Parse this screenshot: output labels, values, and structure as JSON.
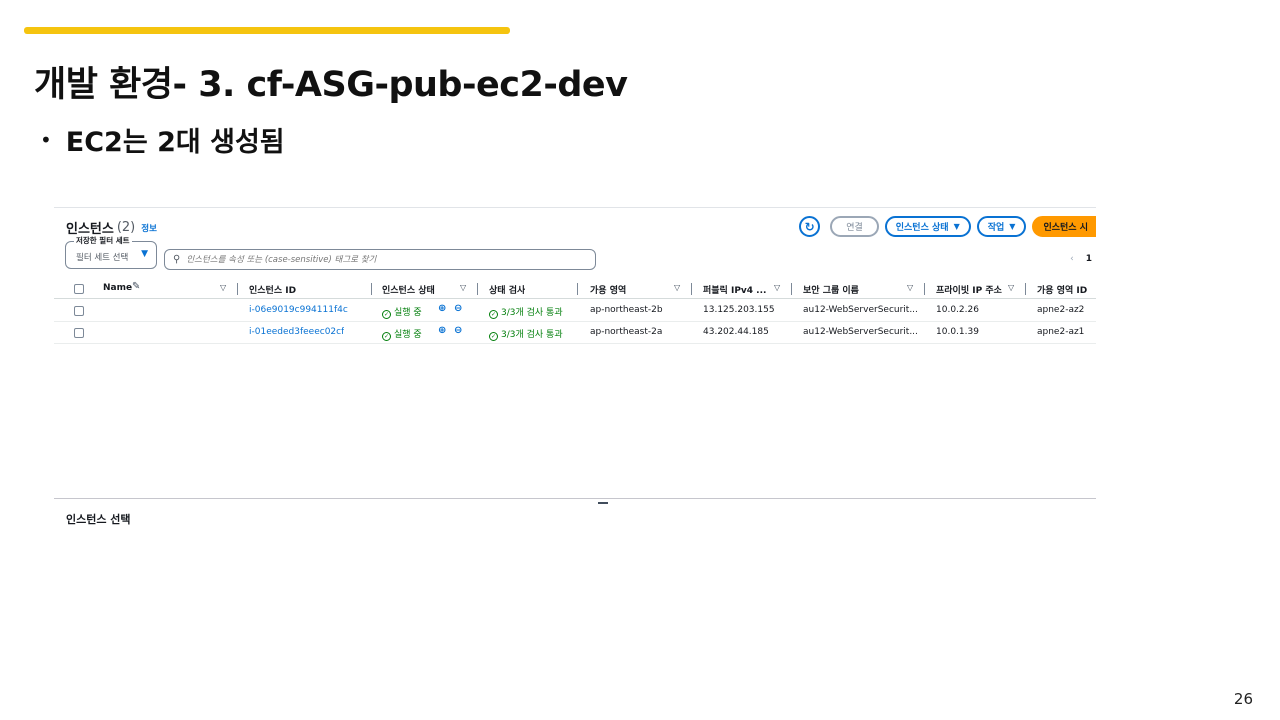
{
  "slide": {
    "title": "개발 환경- 3. cf-ASG-pub-ec2-dev",
    "bullet": "EC2는 2대 생성됨",
    "bullet_marker": "•",
    "page_number": "26",
    "accent_color": "#f5c40f"
  },
  "console": {
    "header": {
      "title": "인스턴스",
      "count": "(2)",
      "info_link": "정보"
    },
    "actions": {
      "refresh_icon": "refresh-icon",
      "connect_label": "연결",
      "instance_state_label": "인스턴스 상태",
      "actions_label": "작업",
      "launch_label": "인스턴스 시"
    },
    "filter": {
      "saved_filter_label": "저장한 필터 세트",
      "saved_filter_value": "필터 세트 선택",
      "search_placeholder": "인스턴스를 속성 또는 (case-sensitive) 태그로 찾기"
    },
    "pagination": {
      "prev": "‹",
      "page": "1"
    },
    "table": {
      "headers": {
        "name": "Name",
        "instance_id": "인스턴스 ID",
        "instance_state": "인스턴스 상태",
        "status_check": "상태 검사",
        "az": "가용 영역",
        "public_ipv4": "퍼블릭 IPv4 ...",
        "security_group": "보안 그룹 이름",
        "private_ip": "프라이빗 IP 주소",
        "az_id": "가용 영역 ID"
      },
      "rows": [
        {
          "name": "",
          "instance_id": "i-06e9019c994111f4c",
          "instance_state": "실행 중",
          "status_check": "3/3개 검사 통과",
          "az": "ap-northeast-2b",
          "public_ipv4": "13.125.203.155",
          "security_group": "au12-WebServerSecurit...",
          "private_ip": "10.0.2.26",
          "az_id": "apne2-az2"
        },
        {
          "name": "",
          "instance_id": "i-01eeded3feeec02cf",
          "instance_state": "실행 중",
          "status_check": "3/3개 검사 통과",
          "az": "ap-northeast-2a",
          "public_ipv4": "43.202.44.185",
          "security_group": "au12-WebServerSecurit...",
          "private_ip": "10.0.1.39",
          "az_id": "apne2-az1"
        }
      ]
    },
    "bottom_panel": {
      "label": "인스턴스 선택"
    }
  }
}
